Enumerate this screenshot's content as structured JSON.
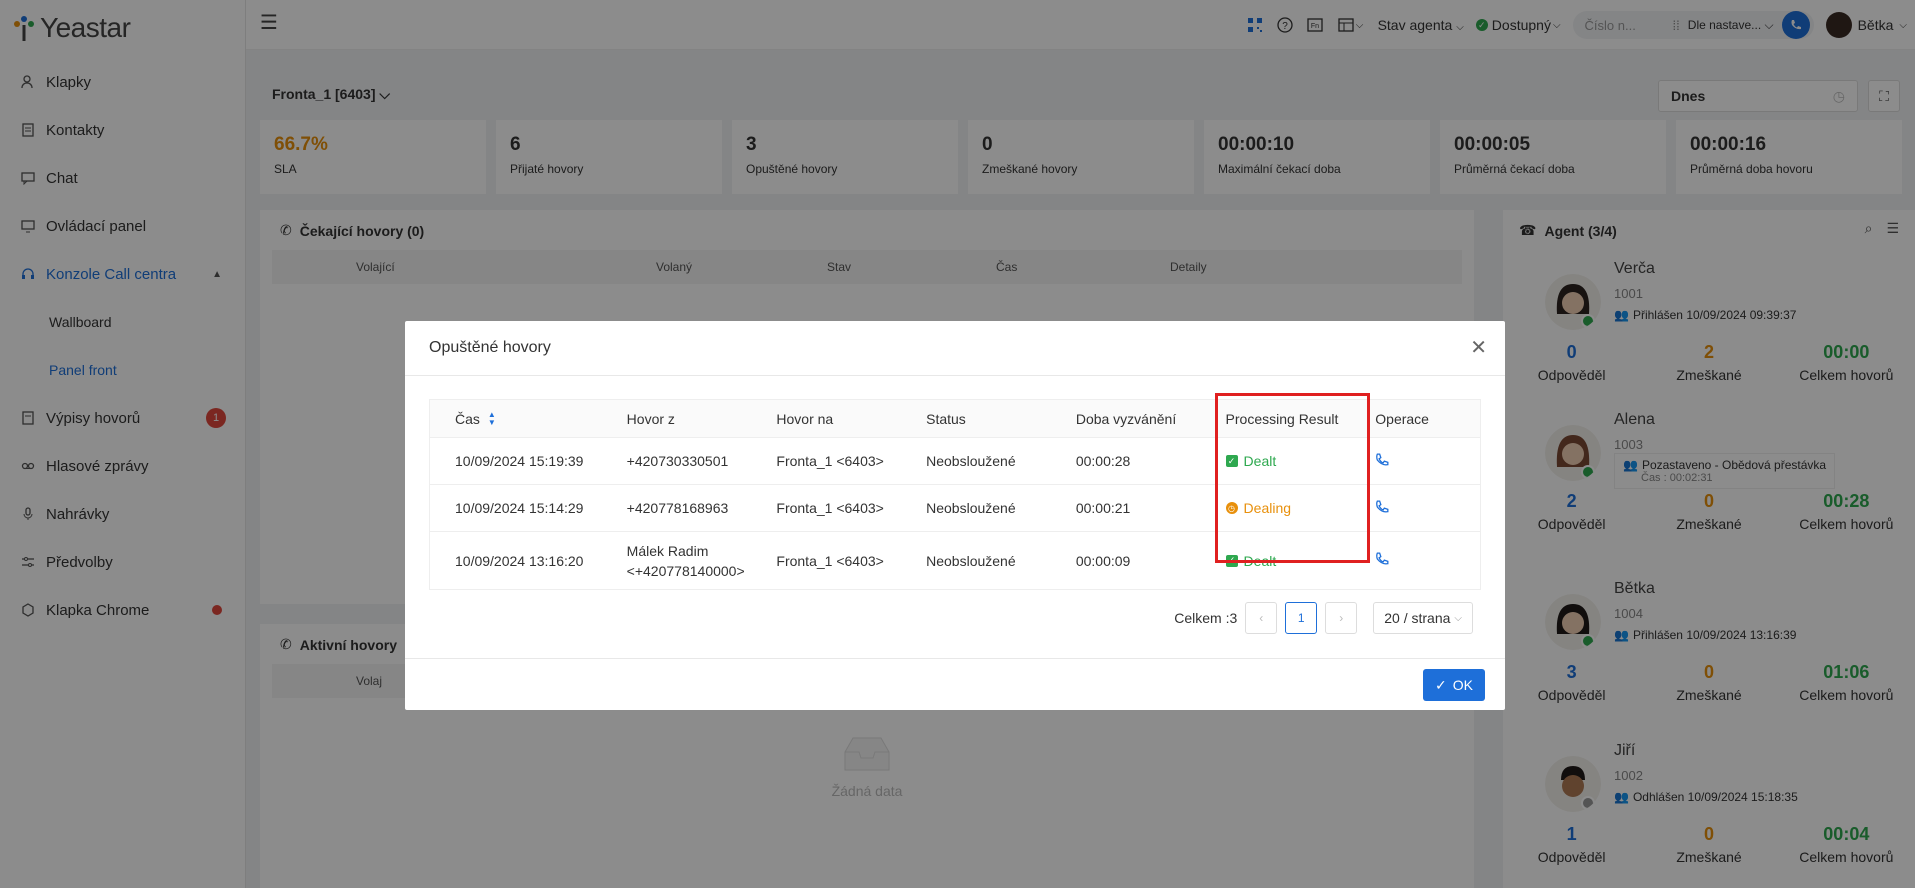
{
  "app": {
    "brand": "Yeastar"
  },
  "sidebar": {
    "items": [
      {
        "label": "Klapky",
        "icon": "user-icon"
      },
      {
        "label": "Kontakty",
        "icon": "contacts-icon"
      },
      {
        "label": "Chat",
        "icon": "chat-icon"
      },
      {
        "label": "Ovládací panel",
        "icon": "dashboard-icon"
      },
      {
        "label": "Konzole Call centra",
        "icon": "headset-icon"
      },
      {
        "label": "Wallboard"
      },
      {
        "label": "Panel front"
      },
      {
        "label": "Výpisy hovorů",
        "icon": "log-icon",
        "badge": "1"
      },
      {
        "label": "Hlasové zprávy",
        "icon": "voicemail-icon"
      },
      {
        "label": "Nahrávky",
        "icon": "mic-icon"
      },
      {
        "label": "Předvolby",
        "icon": "settings-icon"
      },
      {
        "label": "Klapka Chrome",
        "icon": "chrome-icon"
      }
    ]
  },
  "topbar": {
    "agent_status": "Stav agenta",
    "availability": "Dostupný",
    "number_placeholder": "Číslo n...",
    "dial_mode": "Dle nastave...",
    "user": "Bětka"
  },
  "main": {
    "queue": "Fronta_1 [6403]",
    "date": "Dnes",
    "stats": [
      {
        "value": "66.7%",
        "label": "SLA"
      },
      {
        "value": "6",
        "label": "Přijaté hovory"
      },
      {
        "value": "3",
        "label": "Opuštěné hovory"
      },
      {
        "value": "0",
        "label": "Zmeškané hovory"
      },
      {
        "value": "00:00:10",
        "label": "Maximální čekací doba"
      },
      {
        "value": "00:00:05",
        "label": "Průměrná čekací doba"
      },
      {
        "value": "00:00:16",
        "label": "Průměrná doba hovoru"
      }
    ],
    "waiting": {
      "title": "Čekající hovory (0)",
      "cols": [
        "Volající",
        "Volaný",
        "Stav",
        "Čas",
        "Detaily"
      ]
    },
    "active": {
      "title": "Aktivní hovory",
      "col": "Volaj",
      "nodata": "Žádná data"
    }
  },
  "agents": {
    "title": "Agent (3/4)",
    "labels": {
      "answered": "Odpověděl",
      "missed": "Zmeškané",
      "total": "Celkem hovorů"
    },
    "list": [
      {
        "name": "Verča",
        "ext": "1001",
        "status": "Přihlášen 10/09/2024 09:39:37",
        "answered": "0",
        "missed": "2",
        "total": "00:00"
      },
      {
        "name": "Alena",
        "ext": "1003",
        "status": "Pozastaveno - Obědová přestávka",
        "status2": "Čas : 00:02:31",
        "answered": "2",
        "missed": "0",
        "total": "00:28"
      },
      {
        "name": "Bětka",
        "ext": "1004",
        "status": "Přihlášen 10/09/2024 13:16:39",
        "answered": "3",
        "missed": "0",
        "total": "01:06"
      },
      {
        "name": "Jiří",
        "ext": "1002",
        "status": "Odhlášen 10/09/2024 15:18:35",
        "answered": "1",
        "missed": "0",
        "total": "00:04"
      }
    ]
  },
  "modal": {
    "title": "Opuštěné hovory",
    "columns": [
      "Čas",
      "Hovor z",
      "Hovor na",
      "Status",
      "Doba vyzvánění",
      "Processing Result",
      "Operace"
    ],
    "rows": [
      {
        "time": "10/09/2024 15:19:39",
        "from": "+420730330501",
        "from2": "",
        "to": "Fronta_1 <6403>",
        "status": "Neobsloužené",
        "ring": "00:00:28",
        "result": "Dealt"
      },
      {
        "time": "10/09/2024 15:14:29",
        "from": "+420778168963",
        "from2": "",
        "to": "Fronta_1 <6403>",
        "status": "Neobsloužené",
        "ring": "00:00:21",
        "result": "Dealing"
      },
      {
        "time": "10/09/2024 13:16:20",
        "from": "Málek Radim",
        "from2": "<+420778140000>",
        "to": "Fronta_1 <6403>",
        "status": "Neobsloužené",
        "ring": "00:00:09",
        "result": "Dealt"
      }
    ],
    "total": "Celkem :3",
    "page": "1",
    "page_size": "20 / strana",
    "ok": "OK"
  }
}
